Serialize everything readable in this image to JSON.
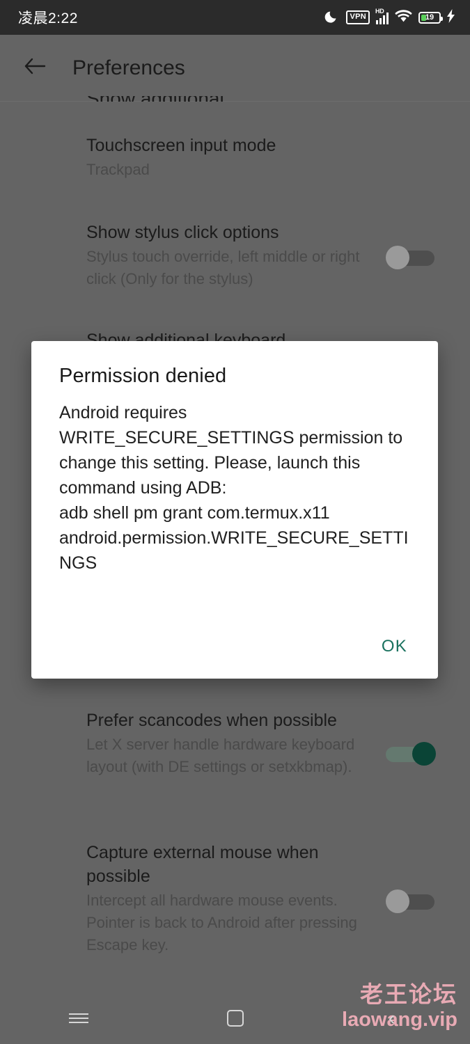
{
  "status_bar": {
    "time": "凌晨2:22",
    "icons": [
      "moon-icon",
      "vpn-badge",
      "hd-signal-icon",
      "wifi-icon",
      "battery-icon",
      "charging-bolt-icon"
    ],
    "vpn_label": "VPN",
    "hd_label": "HD",
    "battery_level": "19"
  },
  "toolbar": {
    "back_icon": "arrow-left-icon",
    "title": "Preferences"
  },
  "clipped_top_item": "Show additional",
  "preferences": [
    {
      "title": "Touchscreen input mode",
      "summary": "Trackpad",
      "has_toggle": false
    },
    {
      "title": "Show stylus click options",
      "summary": "Stylus touch override, left middle or right click (Only for the stylus)",
      "has_toggle": true,
      "toggle_state": "off"
    },
    {
      "title": "Show additional keyboard",
      "summary": "",
      "has_toggle": false,
      "clipped": true
    },
    {
      "title": "Prefer scancodes when possible",
      "summary": "Let X server handle hardware keyboard layout (with DE settings or setxkbmap).",
      "has_toggle": true,
      "toggle_state": "on"
    },
    {
      "title": "Capture external mouse when possible",
      "summary": "Intercept all hardware mouse events. Pointer is back to Android after pressing Escape key.",
      "has_toggle": true,
      "toggle_state": "off"
    }
  ],
  "dialog": {
    "title": "Permission denied",
    "message": "Android requires WRITE_SECURE_SETTINGS permission to change this setting. Please, launch this command using ADB:\nadb shell pm grant com.termux.x11 android.permission.WRITE_SECURE_SETTINGS",
    "ok_label": "OK",
    "accent_color": "#19715e"
  },
  "watermark": {
    "line1": "老王论坛",
    "line2": "laowang.vip",
    "color": "#e8aab4"
  },
  "nav_bar": {
    "recents_icon": "hamburger-icon",
    "home_icon": "square-icon",
    "back_icon": "chevron-left-icon"
  },
  "colors": {
    "scrim_background": "#646464",
    "status_bar": "#2b2b2b",
    "dialog_surface": "#ffffff",
    "toggle_on": "#0a4436",
    "toggle_off": "#9a9a9a"
  }
}
